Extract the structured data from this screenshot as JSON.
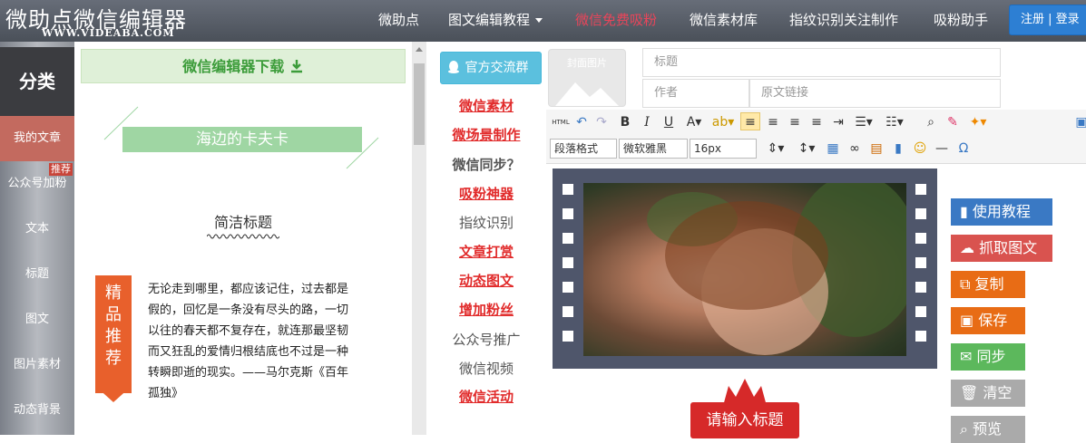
{
  "header": {
    "logo": "微助点微信编辑器",
    "logo_sub": "WWW.VIDEABA.COM",
    "nav": [
      {
        "label": "微助点"
      },
      {
        "label": "图文编辑教程"
      },
      {
        "label": "微信免费吸粉"
      },
      {
        "label": "微信素材库"
      },
      {
        "label": "指纹识别关注制作"
      },
      {
        "label": "吸粉助手"
      }
    ],
    "login": "注册 | 登录",
    "colors": {
      "highlight": "#e8455a",
      "login_bg": "#2d7fd3"
    }
  },
  "sidebar": {
    "title": "分类",
    "items": [
      {
        "label": "我的文章"
      },
      {
        "label": "公众号加粉",
        "badge": "推荐"
      },
      {
        "label": "文本"
      },
      {
        "label": "标题"
      },
      {
        "label": "图文"
      },
      {
        "label": "图片素材"
      },
      {
        "label": "动态背景"
      }
    ]
  },
  "left_panel": {
    "download": "微信编辑器下载",
    "ribbon_title": "海边的卡夫卡",
    "simple_title": "简洁标题",
    "tag": "精品推荐",
    "poem": "无论走到哪里，都应该记住，过去都是假的，回忆是一条没有尽头的路，一切以往的春天都不复存在，就连那最坚韧而又狂乱的爱情归根结底也不过是一种转瞬即逝的现实。——马尔克斯《百年孤独》"
  },
  "middle_panel": {
    "qq_group": "官方交流群",
    "links": [
      {
        "label": "微信素材",
        "style": "red"
      },
      {
        "label": "微场景制作",
        "style": "red"
      },
      {
        "label": "微信同步？",
        "style": "bold"
      },
      {
        "label": "吸粉神器",
        "style": "red"
      },
      {
        "label": "指纹识别",
        "style": "plain"
      },
      {
        "label": "文章打赏",
        "style": "red"
      },
      {
        "label": "动态图文",
        "style": "red"
      },
      {
        "label": "增加粉丝",
        "style": "red"
      },
      {
        "label": "公众号推广",
        "style": "plain"
      },
      {
        "label": "微信视频",
        "style": "plain"
      },
      {
        "label": "微信活动",
        "style": "red"
      }
    ]
  },
  "editor": {
    "cover_label": "封面图片",
    "title_placeholder": "标题",
    "author_placeholder": "作者",
    "link_placeholder": "原文链接",
    "toolbar": {
      "paragraph": "段落格式",
      "font": "微软雅黑",
      "size": "16px"
    },
    "title_ribbon": "请输入标题"
  },
  "actions": [
    {
      "label": "使用教程",
      "color": "#3a79c4"
    },
    {
      "label": "抓取图文",
      "color": "#d9534f"
    },
    {
      "label": "复制",
      "color": "#e86c15"
    },
    {
      "label": "保存",
      "color": "#e86c15"
    },
    {
      "label": "同步",
      "color": "#5cb85c"
    },
    {
      "label": "清空",
      "color": "#aaaaaa"
    },
    {
      "label": "预览",
      "color": "#aaaaaa"
    }
  ]
}
